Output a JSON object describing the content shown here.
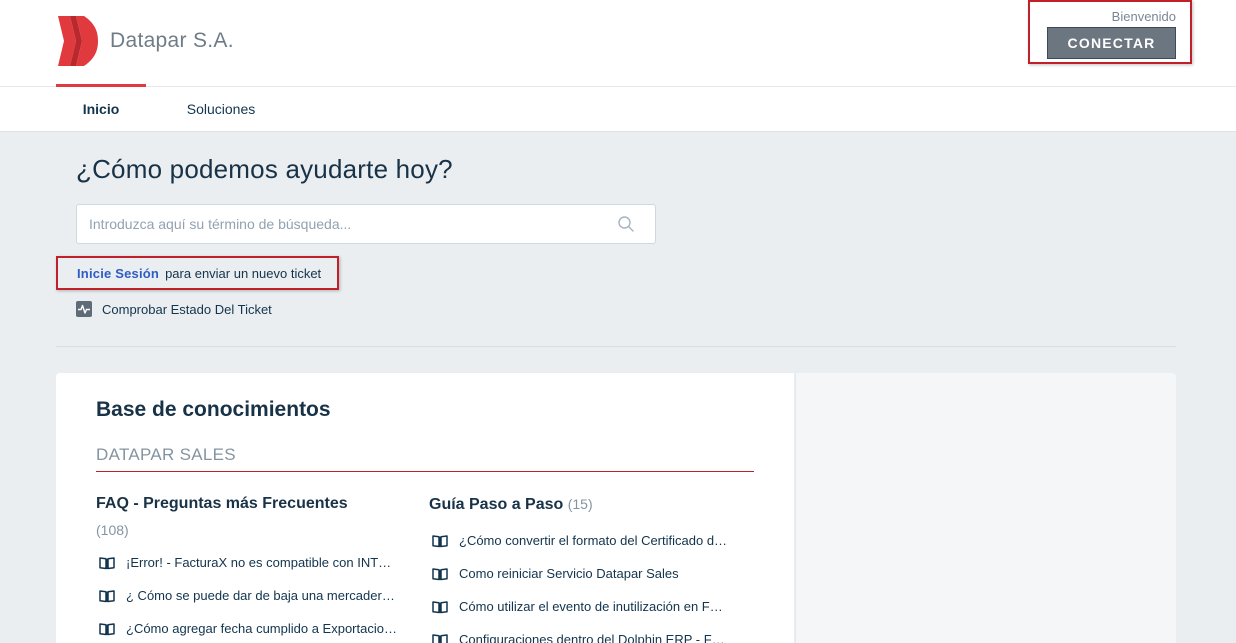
{
  "header": {
    "brand_name": "Datapar S.A.",
    "welcome_text": "Bienvenido",
    "connect_label": "CONECTAR",
    "brand_color": "#e03a3e"
  },
  "nav": {
    "items": [
      {
        "label": "Inicio",
        "active": true
      },
      {
        "label": "Soluciones",
        "active": false
      }
    ]
  },
  "hero": {
    "title": "¿Cómo podemos ayudarte hoy?",
    "search_placeholder": "Introduzca aquí su término de búsqueda...",
    "signin_link": "Inicie Sesión",
    "signin_rest": "para enviar un nuevo ticket",
    "status_label": "Comprobar Estado Del Ticket"
  },
  "kb": {
    "title": "Base de conocimientos",
    "category": "DATAPAR SALES",
    "folders": [
      {
        "title": "FAQ - Preguntas más Frecuentes",
        "count": "(108)",
        "articles": [
          "¡Error! - FacturaX no es compatible con INTE…",
          "¿ Cómo se puede dar de baja una mercaderí…",
          "¿Cómo agregar fecha cumplido a Exportacio…"
        ]
      },
      {
        "title": "Guía Paso a Paso",
        "count": "(15)",
        "articles": [
          "¿Cómo convertir el formato del Certificado d…",
          "Como reiniciar Servicio Datapar Sales",
          "Cómo utilizar el evento de inutilización en F…",
          "Configuraciones dentro del Dolphin ERP - Fa…"
        ]
      }
    ]
  },
  "icons": {
    "search": "search-icon",
    "status": "activity-pulse-icon",
    "article": "book-open-icon",
    "logo": "datapar-logo"
  }
}
